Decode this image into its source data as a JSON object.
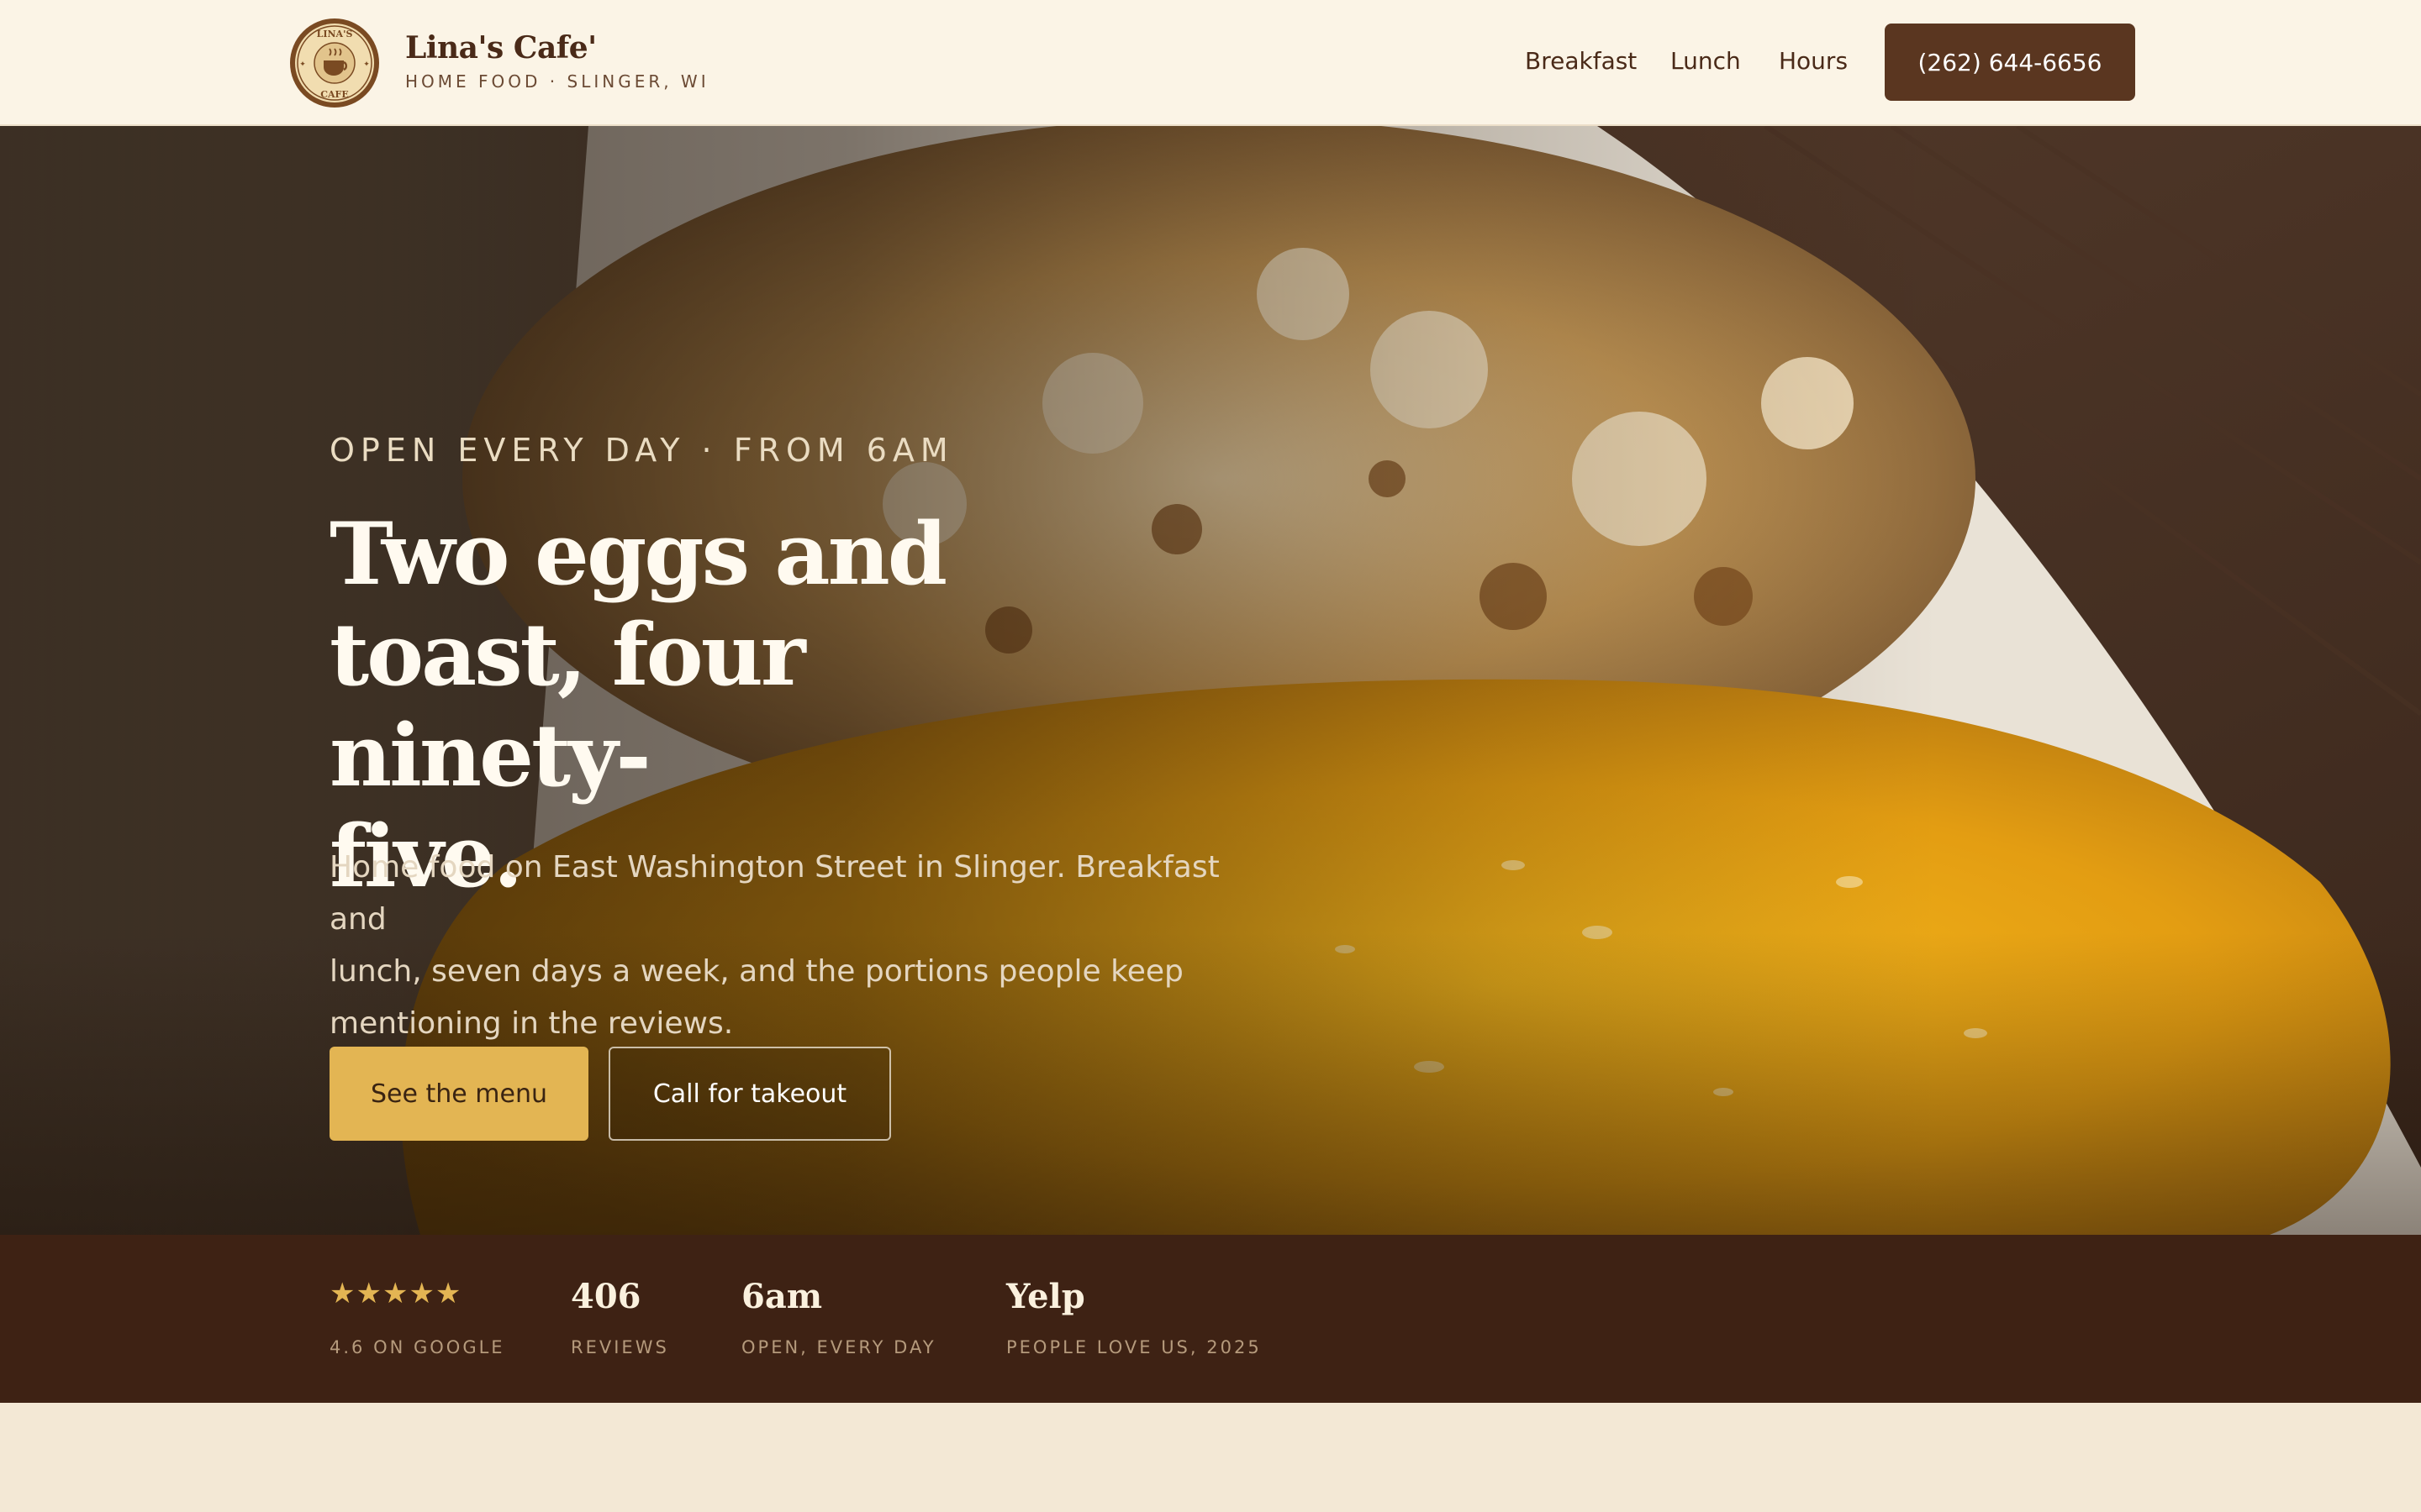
{
  "header": {
    "brand_name": "Lina's Cafe'",
    "brand_tagline": "HOME FOOD · SLINGER, WI",
    "logo_text": "LINA'S CAFE",
    "nav": [
      "Breakfast",
      "Lunch",
      "Hours"
    ],
    "phone_button": "(262) 644-6656"
  },
  "hero": {
    "eyebrow": "OPEN EVERY DAY · FROM 6AM",
    "headline_lines": [
      "Two eggs and",
      "toast, four ninety-",
      "five."
    ],
    "subtext_lines": [
      "Home food on East Washington Street in Slinger. Breakfast and",
      "lunch, seven days a week, and the portions people keep",
      "mentioning in the reviews."
    ],
    "primary_button": "See the menu",
    "secondary_button": "Call for takeout"
  },
  "stats": [
    {
      "value": "★★★★★",
      "label": "4.6 ON GOOGLE",
      "rating": 4.6
    },
    {
      "value": "406",
      "label": "REVIEWS"
    },
    {
      "value": "6am",
      "label": "OPEN, EVERY DAY"
    },
    {
      "value": "Yelp",
      "label": "PEOPLE LOVE US, 2025"
    }
  ],
  "colors": {
    "header_bg": "#fbf4e6",
    "brand_brown": "#5a3620",
    "accent_gold": "#e3b553",
    "stats_bg": "#3e2214",
    "page_bg": "#f3e8d5"
  }
}
